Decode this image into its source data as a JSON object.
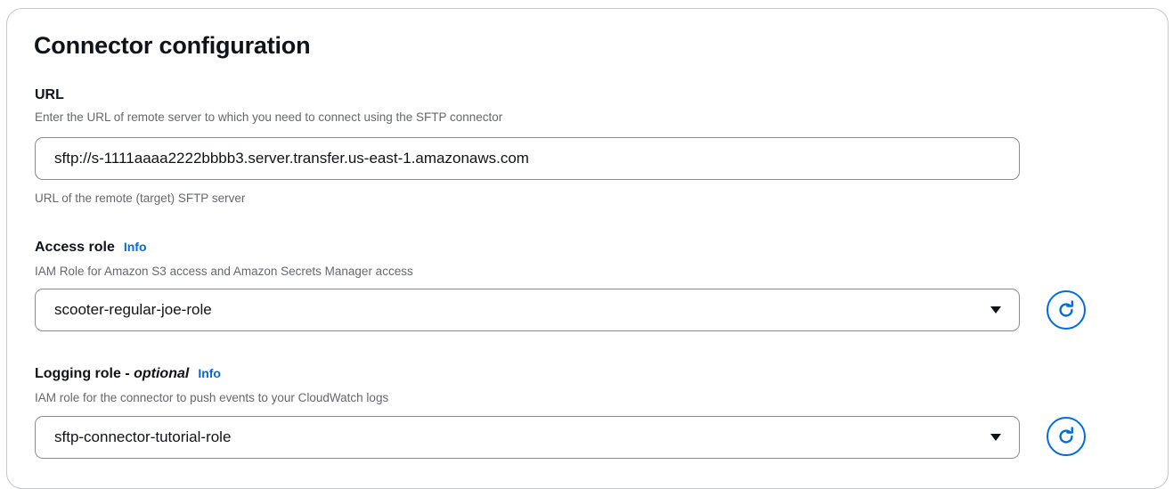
{
  "section": {
    "title": "Connector configuration"
  },
  "url": {
    "label": "URL",
    "description": "Enter the URL of remote server to which you need to connect using the SFTP connector",
    "value": "sftp://s-1111aaaa2222bbbb3.server.transfer.us-east-1.amazonaws.com",
    "constraint": "URL of the remote (target) SFTP server"
  },
  "access_role": {
    "label": "Access role",
    "info": "Info",
    "description": "IAM Role for Amazon S3 access and Amazon Secrets Manager access",
    "selected": "scooter-regular-joe-role",
    "caret_icon": "caret-down-icon",
    "refresh_icon": "refresh-icon"
  },
  "logging_role": {
    "label": "Logging role - ",
    "label_optional": "optional",
    "info": "Info",
    "description": "IAM role for the connector to push events to your CloudWatch logs",
    "selected": "sftp-connector-tutorial-role",
    "caret_icon": "caret-down-icon",
    "refresh_icon": "refresh-icon"
  },
  "colors": {
    "accent": "#006ce0",
    "text": "#0f141a",
    "muted": "#656871",
    "border": "#8c8c94"
  }
}
